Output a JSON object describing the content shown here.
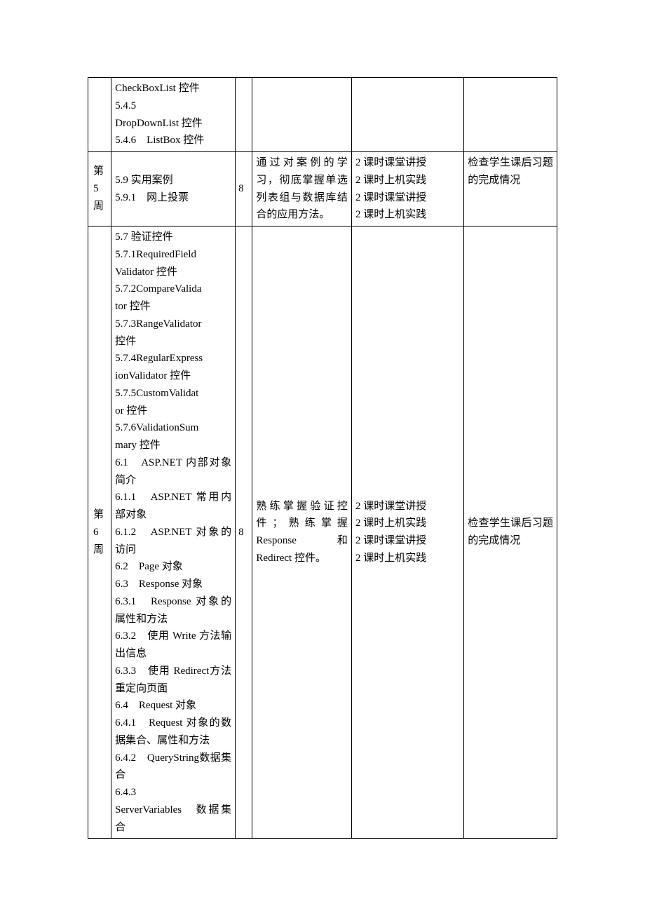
{
  "rows": [
    {
      "week": "",
      "content_lines": [
        "CheckBoxList 控件",
        "5.4.5",
        "DropDownList 控件",
        "5.4.6　ListBox 控件"
      ],
      "hours": "",
      "objective": "",
      "method_lines": [],
      "check": ""
    },
    {
      "week": "第 5 周",
      "content_lines": [
        "5.9 实用案例",
        "5.9.1　网上投票"
      ],
      "hours": "8",
      "objective": "通过对案例的学习，彻底掌握单选列表组与数据库结合的应用方法。",
      "method_lines": [
        "2 课时课堂讲授",
        "2 课时上机实践",
        "2 课时课堂讲授",
        "2 课时上机实践"
      ],
      "check": "检查学生课后习题的完成情况"
    },
    {
      "week": "第 6 周",
      "content_lines": [
        "5.7 验证控件",
        "5.7.1RequiredField",
        "Validator 控件",
        "5.7.2CompareValida",
        "tor 控件",
        "5.7.3RangeValidator",
        "控件",
        "5.7.4RegularExpress",
        "ionValidator 控件",
        "5.7.5CustomValidat",
        "or 控件",
        "5.7.6ValidationSum",
        "mary 控件",
        "6.1　ASP.NET 内部对象简介",
        "6.1.1　ASP.NET 常用内部对象",
        "6.1.2　ASP.NET 对象的访问",
        "6.2　Page 对象",
        "6.3　Response 对象",
        "6.3.1　Response 对象的属性和方法",
        "6.3.2　使用 Write 方法输出信息",
        "6.3.3　使用 Redirect方法重定向页面",
        "6.4　Request 对象",
        "6.4.1　Request 对象的数据集合、属性和方法",
        "6.4.2　QueryString数据集合",
        "6.4.3",
        "ServerVariables　数据集合"
      ],
      "hours": "8",
      "objective_html": "熟练掌握验证控件；熟练掌握 Response 和 Redirect 控件。",
      "method_lines": [
        "2 课时课堂讲授",
        "2 课时上机实践",
        "2 课时课堂讲授",
        "2 课时上机实践"
      ],
      "check": "检查学生课后习题的完成情况"
    }
  ]
}
